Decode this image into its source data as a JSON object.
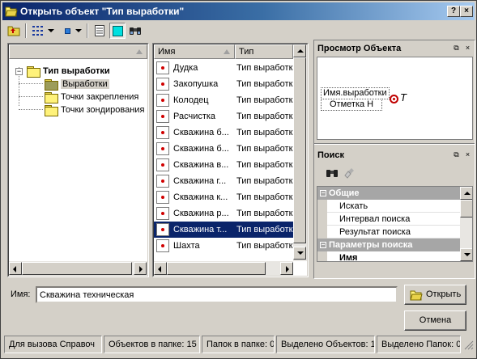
{
  "window": {
    "title": "Открыть объект \"Тип выработки\"",
    "help_label": "?",
    "close_label": "×"
  },
  "tree": {
    "root": "Тип выработки",
    "expander": "−",
    "children": [
      "Выработки",
      "Точки закрепления",
      "Точки зондирования"
    ]
  },
  "list": {
    "col_name": "Имя",
    "col_type": "Тип",
    "rows": [
      {
        "name": "Дудка",
        "type": "Тип выработки"
      },
      {
        "name": "Закопушка",
        "type": "Тип выработки"
      },
      {
        "name": "Колодец",
        "type": "Тип выработки"
      },
      {
        "name": "Расчистка",
        "type": "Тип выработки"
      },
      {
        "name": "Скважина б...",
        "type": "Тип выработки"
      },
      {
        "name": "Скважина б...",
        "type": "Тип выработки"
      },
      {
        "name": "Скважина в...",
        "type": "Тип выработки"
      },
      {
        "name": "Скважина г...",
        "type": "Тип выработки"
      },
      {
        "name": "Скважина к...",
        "type": "Тип выработки"
      },
      {
        "name": "Скважина р...",
        "type": "Тип выработки"
      },
      {
        "name": "Скважина т...",
        "type": "Тип выработки"
      },
      {
        "name": "Шахта",
        "type": "Тип выработки"
      }
    ],
    "selected_index": 10
  },
  "preview": {
    "title": "Просмотр Объекта",
    "label1": "Имя.выработки",
    "label2": "Отметка Н",
    "symbol": "T"
  },
  "search": {
    "title": "Поиск",
    "groups": [
      {
        "label": "Общие",
        "items": [
          "Искать",
          "Интервал поиска",
          "Результат поиска"
        ]
      },
      {
        "label": "Параметры поиска",
        "items": [
          "Имя"
        ]
      }
    ]
  },
  "form": {
    "name_label": "Имя:",
    "name_value": "Скважина техническая",
    "open_button": "Открыть",
    "cancel_button": "Отмена"
  },
  "status": {
    "help": "Для вызова Справоч",
    "objects": "Объектов в папке: 15",
    "folders": "Папок в папке: 0",
    "selected_objects": "Выделено Объектов: 1",
    "selected_folders": "Выделено Папок: 0"
  }
}
